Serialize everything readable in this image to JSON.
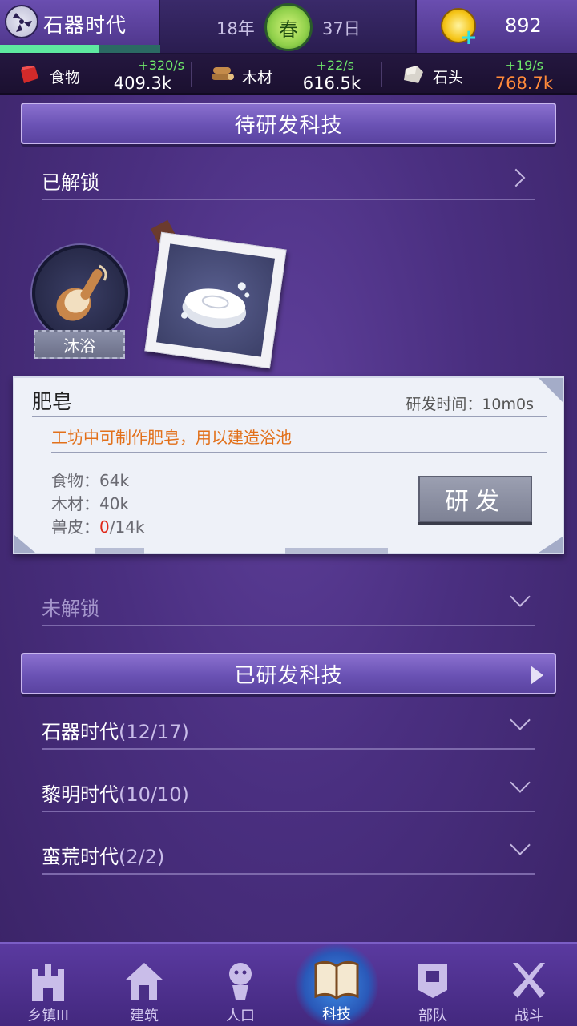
{
  "header": {
    "era_name": "石器时代",
    "era_progress": 0.62,
    "year": "18年",
    "season": "春",
    "day": "37日",
    "coins": "892"
  },
  "resources": [
    {
      "name": "食物",
      "icon": "meat-icon",
      "rate": "+320/s",
      "amount": "409.3k",
      "amount_color": "#ffffff"
    },
    {
      "name": "木材",
      "icon": "wood-icon",
      "rate": "+22/s",
      "amount": "616.5k",
      "amount_color": "#ffffff"
    },
    {
      "name": "石头",
      "icon": "stone-icon",
      "rate": "+19/s",
      "amount": "768.7k",
      "amount_color": "#ff8a3a"
    }
  ],
  "pending": {
    "header": "待研发科技",
    "unlocked_label": "已解锁",
    "node_name": "沐浴",
    "card": {
      "title": "肥皂",
      "time": "研发时间：10m0s",
      "description": "工坊中可制作肥皂，用以建造浴池",
      "costs": [
        {
          "label": "食物：",
          "value": "64k"
        },
        {
          "label": "木材：",
          "value": "40k"
        },
        {
          "label": "兽皮：",
          "current": "0",
          "total": "/14k"
        }
      ],
      "button": "研发"
    },
    "locked_label": "未解锁"
  },
  "researched": {
    "header": "已研发科技",
    "eras": [
      {
        "name": "石器时代",
        "count": "(12/17)"
      },
      {
        "name": "黎明时代",
        "count": "(10/10)"
      },
      {
        "name": "蛮荒时代",
        "count": "(2/2)"
      }
    ]
  },
  "nav": [
    {
      "label": "乡镇III",
      "icon": "castle-icon"
    },
    {
      "label": "建筑",
      "icon": "house-icon"
    },
    {
      "label": "人口",
      "icon": "person-icon"
    },
    {
      "label": "科技",
      "icon": "book-icon",
      "active": true
    },
    {
      "label": "部队",
      "icon": "banner-icon"
    },
    {
      "label": "战斗",
      "icon": "crossed-swords-icon"
    }
  ],
  "colors": {
    "rate_green": "#6ee86a",
    "stone_amount_orange": "#ff8a3a",
    "description_orange": "#e2701a",
    "shortfall_red": "#e0291b"
  }
}
